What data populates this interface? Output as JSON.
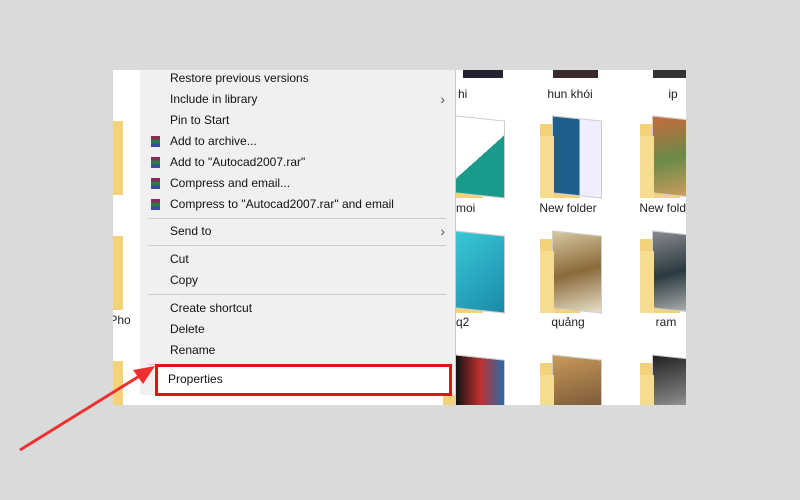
{
  "folders": [
    {
      "name": "hi"
    },
    {
      "name": "hun khói"
    },
    {
      "name": "ip"
    },
    {
      "name": "moi"
    },
    {
      "name": "New folder"
    },
    {
      "name": "New folde"
    },
    {
      "name": "Pho"
    },
    {
      "name": "q2"
    },
    {
      "name": "quảng"
    },
    {
      "name": "ram"
    }
  ],
  "menu": {
    "items": [
      {
        "label": "Restore previous versions"
      },
      {
        "label": "Include in library",
        "arrow": "›"
      },
      {
        "label": "Pin to Start"
      },
      {
        "label": "Add to archive..."
      },
      {
        "label": "Add to \"Autocad2007.rar\""
      },
      {
        "label": "Compress and email..."
      },
      {
        "label": "Compress to \"Autocad2007.rar\" and email"
      },
      {
        "label": "Send to",
        "arrow": "›"
      },
      {
        "label": "Cut"
      },
      {
        "label": "Copy"
      },
      {
        "label": "Create shortcut"
      },
      {
        "label": "Delete"
      },
      {
        "label": "Rename"
      },
      {
        "label": "Properties"
      }
    ]
  },
  "colors": {
    "highlight": "#e01515",
    "arrow": "#f03030"
  }
}
